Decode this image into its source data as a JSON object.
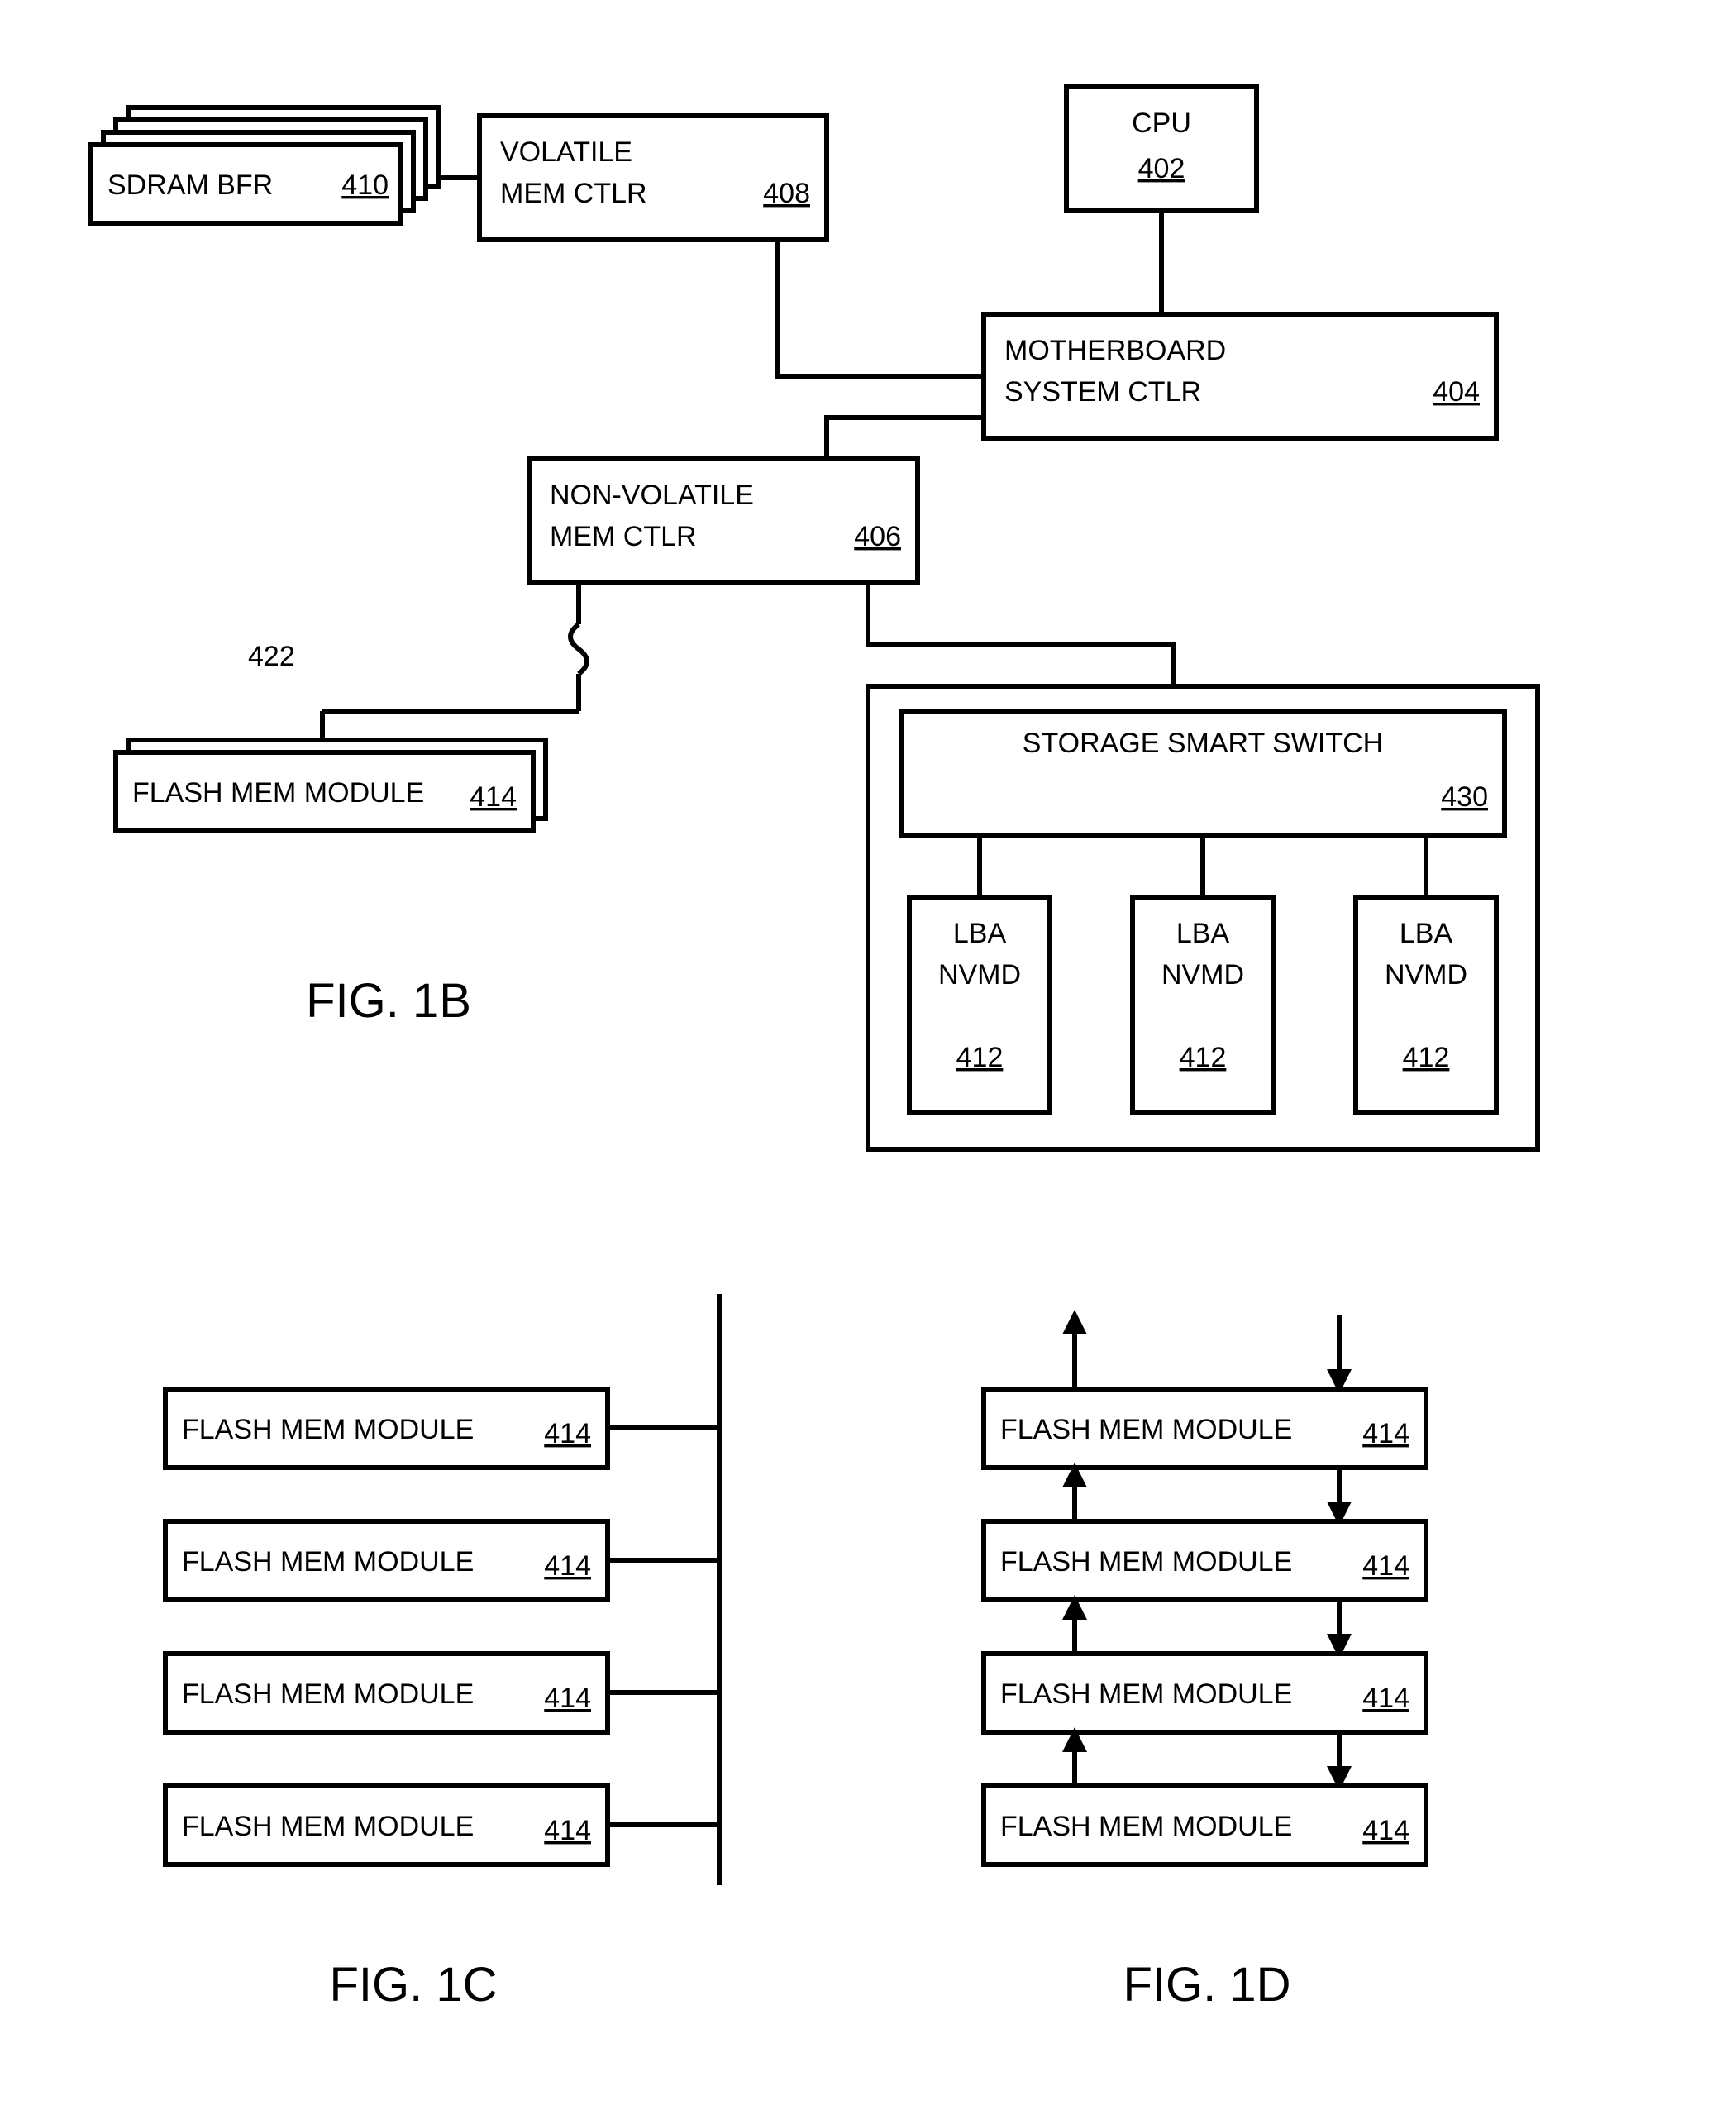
{
  "fig1b": {
    "cpu": {
      "label": "CPU",
      "ref": "402"
    },
    "mbctlr": {
      "line1": "MOTHERBOARD",
      "line2": "SYSTEM CTLR",
      "ref": "404"
    },
    "volctlr": {
      "line1": "VOLATILE",
      "line2": "MEM CTLR",
      "ref": "408"
    },
    "nvctlr": {
      "line1": "NON-VOLATILE",
      "line2": "MEM CTLR",
      "ref": "406"
    },
    "sdram": {
      "label": "SDRAM  BFR",
      "ref": "410"
    },
    "flashmod": {
      "label": "FLASH MEM MODULE",
      "ref": "414"
    },
    "wave_ref": "422",
    "switch": {
      "label": "STORAGE SMART SWITCH",
      "ref": "430"
    },
    "lba": {
      "line1": "LBA",
      "line2": "NVMD",
      "ref": "412"
    },
    "caption": "FIG. 1B"
  },
  "fig1c": {
    "module": {
      "label": "FLASH MEM MODULE",
      "ref": "414"
    },
    "caption": "FIG. 1C"
  },
  "fig1d": {
    "module": {
      "label": "FLASH MEM MODULE",
      "ref": "414"
    },
    "caption": "FIG. 1D"
  }
}
